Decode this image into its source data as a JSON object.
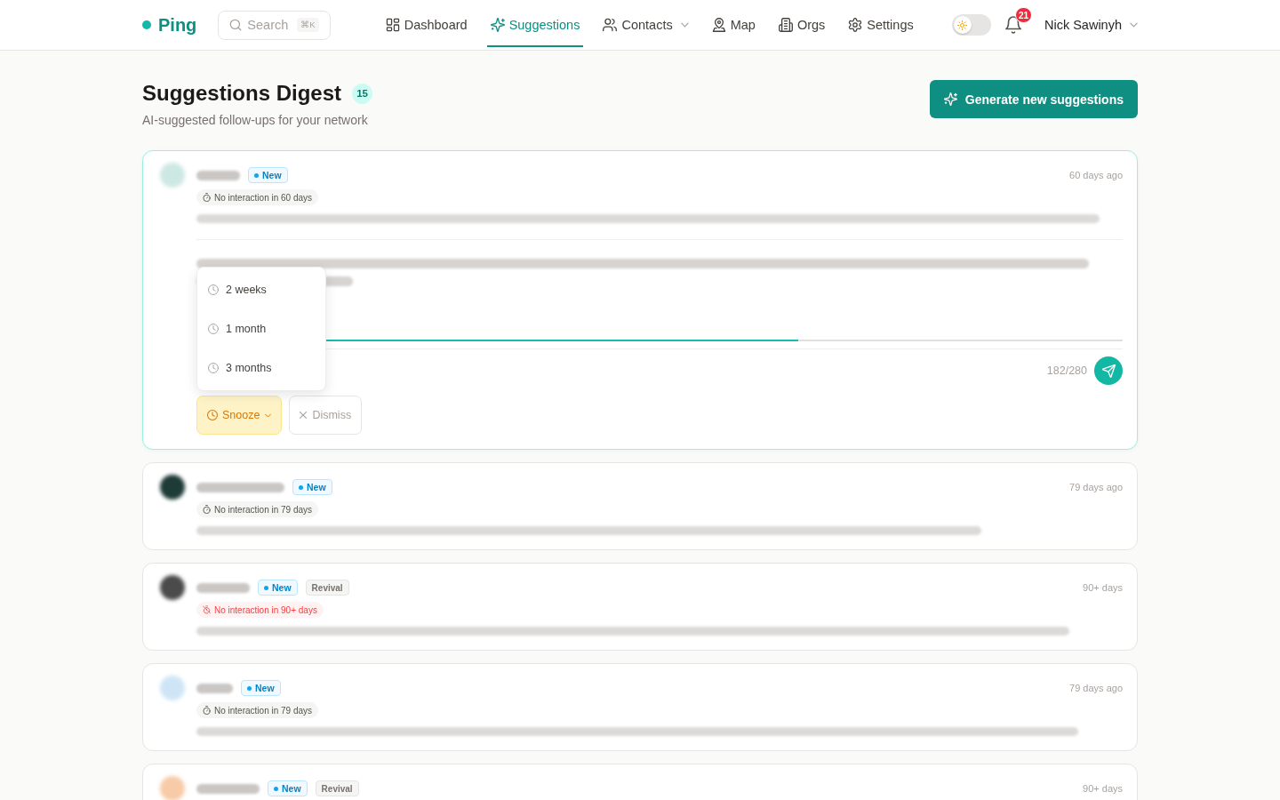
{
  "nav": {
    "brand": "Ping",
    "search": {
      "placeholder": "Search",
      "shortcut": "⌘K"
    },
    "items": [
      {
        "label": "Dashboard",
        "selected": false,
        "dropdown": false
      },
      {
        "label": "Suggestions",
        "selected": true,
        "dropdown": false
      },
      {
        "label": "Contacts",
        "selected": false,
        "dropdown": true
      },
      {
        "label": "Map",
        "selected": false,
        "dropdown": false
      },
      {
        "label": "Orgs",
        "selected": false,
        "dropdown": false
      },
      {
        "label": "Settings",
        "selected": false,
        "dropdown": false
      }
    ],
    "theme_toggle": {
      "on": false
    },
    "notifications": {
      "count": "21"
    },
    "user": {
      "name": "Nick Sawinyh"
    }
  },
  "header": {
    "title": "Suggestions Digest",
    "count": "15",
    "subtitle": "AI-suggested follow-ups for your network",
    "generate_button": "Generate new suggestions"
  },
  "suggestions": [
    {
      "color": "#cde8e3",
      "status": "New",
      "inactivity": {
        "text": "No interaction in 60 days",
        "overdue": false
      },
      "age": "60 days ago",
      "expanded": true,
      "draft": {
        "level": 0.65,
        "counter": "182/280"
      },
      "snooze": {
        "label": "Snooze",
        "open": true,
        "options": [
          "2 weeks",
          "1 month",
          "3 months"
        ]
      },
      "dismiss": "Dismiss"
    },
    {
      "color": "#1e3b38",
      "status": "New",
      "inactivity": {
        "text": "No interaction in 79 days",
        "overdue": false
      },
      "age": "79 days ago",
      "expanded": false
    },
    {
      "color": "#4b4b4b",
      "status": "New",
      "tags": [
        "Revival"
      ],
      "inactivity": {
        "text": "No interaction in 90+ days",
        "overdue": true
      },
      "age": "90+ days",
      "expanded": false
    },
    {
      "color": "#cfe5f6",
      "status": "New",
      "inactivity": {
        "text": "No interaction in 79 days",
        "overdue": false
      },
      "age": "79 days ago",
      "expanded": false
    },
    {
      "color": "#f8cba8",
      "status": "New",
      "tags": [
        "Revival"
      ],
      "age": "90+ days",
      "expanded": false
    }
  ]
}
